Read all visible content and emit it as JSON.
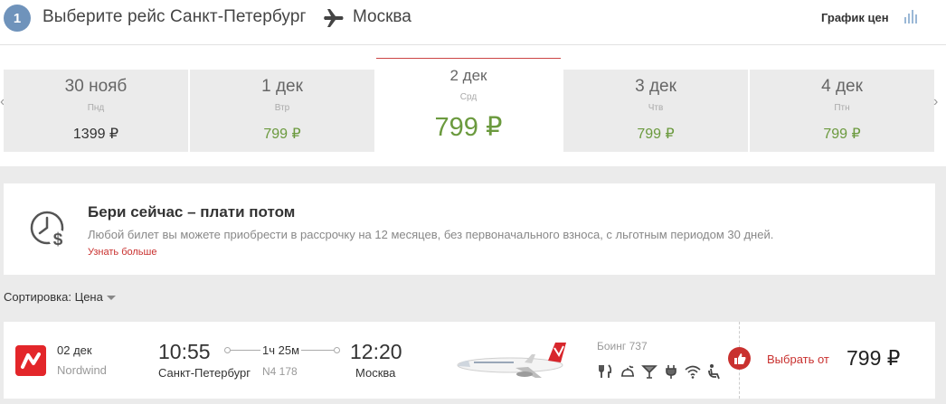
{
  "header": {
    "step": "1",
    "title": "Выберите рейс Санкт-Петербург",
    "destination": "Москва",
    "price_graph": "График цен"
  },
  "dates": [
    {
      "date": "30 нояб",
      "weekday": "Пнд",
      "price": "1399 ₽",
      "active": false
    },
    {
      "date": "1 дек",
      "weekday": "Втр",
      "price": "799 ₽",
      "active": false
    },
    {
      "date": "2 дек",
      "weekday": "Срд",
      "price": "799 ₽",
      "active": true
    },
    {
      "date": "3 дек",
      "weekday": "Чтв",
      "price": "799 ₽",
      "active": false
    },
    {
      "date": "4 дек",
      "weekday": "Птн",
      "price": "799 ₽",
      "active": false
    }
  ],
  "promo": {
    "title": "Бери сейчас – плати потом",
    "text": "Любой билет вы можете приобрести в рассрочку на 12 месяцев, без первоначального взноса, с льготным периодом 30 дней.",
    "link": "Узнать больше"
  },
  "sort": {
    "label": "Сортировка: Цена"
  },
  "flight": {
    "date": "02 дек",
    "airline": "Nordwind",
    "dep_time": "10:55",
    "dep_city": "Санкт-Петербург",
    "duration": "1ч 25м",
    "flight_no": "N4 178",
    "arr_time": "12:20",
    "arr_city": "Москва",
    "aircraft": "Боинг 737",
    "amenities": [
      "meal-icon",
      "snack-icon",
      "drinks-icon",
      "power-icon",
      "wifi-icon",
      "seat-icon"
    ],
    "select_label": "Выбрать от",
    "price": "799 ₽"
  },
  "colors": {
    "accent_red": "#c9312f",
    "price_green": "#6b9a3e",
    "step_blue": "#6f93bb"
  }
}
